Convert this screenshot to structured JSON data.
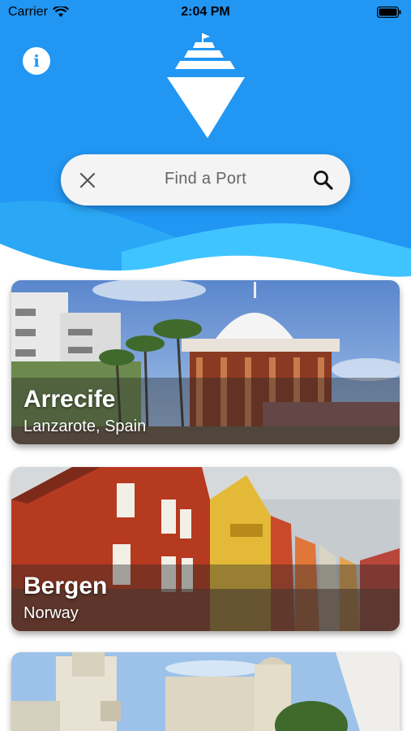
{
  "status_bar": {
    "carrier": "Carrier",
    "time": "2:04 PM"
  },
  "search": {
    "placeholder": "Find a Port"
  },
  "ports": [
    {
      "name": "Arrecife",
      "location": "Lanzarote, Spain"
    },
    {
      "name": "Bergen",
      "location": "Norway"
    },
    {
      "name": "",
      "location": ""
    }
  ],
  "icons": {
    "info": "info-icon",
    "logo": "ship-logo-icon",
    "clear": "close-icon",
    "search": "search-icon",
    "wifi": "wifi-icon",
    "battery": "battery-icon"
  },
  "colors": {
    "header_blue": "#2196f3",
    "wave_light": "#29b6f6",
    "background": "#ffffff"
  }
}
